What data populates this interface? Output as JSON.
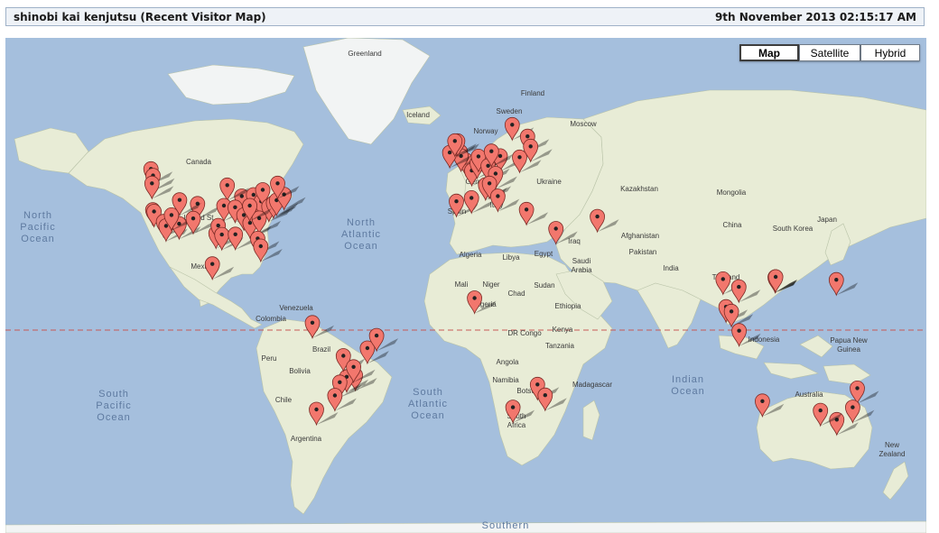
{
  "header": {
    "title": "shinobi kai kenjutsu (Recent Visitor Map)",
    "datetime": "9th November 2013 02:15:17 AM"
  },
  "map_controls": {
    "map": "Map",
    "satellite": "Satellite",
    "hybrid": "Hybrid",
    "active": "Map"
  },
  "colors": {
    "ocean": "#a5bfdd",
    "land": "#e8ecd6",
    "forest": "#c6dca3",
    "ice": "#f2f4f4",
    "desert": "#f1ebd5",
    "marker": "#f2776d",
    "equator": "#c85a55"
  },
  "labels": {
    "greenland": "Greenland",
    "iceland": "Iceland",
    "finland": "Finland",
    "sweden": "Sweden",
    "norway": "Norway",
    "moscow": "Moscow",
    "canada": "Canada",
    "united_states": "United St",
    "mexico": "Mexico",
    "ukraine": "Ukraine",
    "kazakhstan": "Kazakhstan",
    "mongolia": "Mongolia",
    "china": "China",
    "south_korea": "South Korea",
    "japan": "Japan",
    "germany": "Germany",
    "spain": "Spain",
    "italy": "Italy",
    "algeria": "Algeria",
    "libya": "Libya",
    "egypt": "Egypt",
    "iraq": "Iraq",
    "afghanistan": "Afghanistan",
    "pakistan": "Pakistan",
    "india": "India",
    "saudi_arabia": "Saudi\nArabia",
    "mali": "Mali",
    "niger": "Niger",
    "chad": "Chad",
    "sudan": "Sudan",
    "nigeria": "Nigeria",
    "ethiopia": "Ethiopia",
    "dr_congo": "DR Congo",
    "kenya": "Kenya",
    "tanzania": "Tanzania",
    "angola": "Angola",
    "namibia": "Namibia",
    "botswana": "Botswana",
    "madagascar": "Madagascar",
    "south_africa": "South\nAfrica",
    "thailand": "Thailand",
    "indonesia": "Indonesia",
    "papua_new_guinea": "Papua New\nGuinea",
    "australia": "Australia",
    "new_zealand": "New\nZealand",
    "venezuela": "Venezuela",
    "colombia": "Colombia",
    "brazil": "Brazil",
    "peru": "Peru",
    "bolivia": "Bolivia",
    "chile": "Chile",
    "argentina": "Argentina",
    "north_pacific_ocean": "North\nPacific\nOcean",
    "north_atlantic_ocean": "North\nAtlantic\nOcean",
    "south_pacific_ocean": "South\nPacific\nOcean",
    "south_atlantic_ocean": "South\nAtlantic\nOcean",
    "indian_ocean": "Indian\nOcean",
    "southern": "Southern"
  },
  "visitor_markers": [
    [
      -123.1,
      49.3
    ],
    [
      -122.3,
      47.6
    ],
    [
      -122.7,
      45.5
    ],
    [
      -122.4,
      37.8
    ],
    [
      -121.9,
      37.3
    ],
    [
      -118.2,
      34.1
    ],
    [
      -117.2,
      32.7
    ],
    [
      -112.1,
      33.4
    ],
    [
      -115.1,
      36.2
    ],
    [
      -104.9,
      39.7
    ],
    [
      -111.9,
      40.8
    ],
    [
      -106.6,
      35.1
    ],
    [
      -97.7,
      30.3
    ],
    [
      -96.8,
      32.8
    ],
    [
      -95.4,
      29.8
    ],
    [
      -90.1,
      29.9
    ],
    [
      -87.6,
      41.9
    ],
    [
      -93.3,
      45.0
    ],
    [
      -94.6,
      39.1
    ],
    [
      -90.2,
      38.6
    ],
    [
      -86.8,
      36.2
    ],
    [
      -84.4,
      33.7
    ],
    [
      -81.7,
      41.5
    ],
    [
      -83.0,
      42.3
    ],
    [
      -80.0,
      40.4
    ],
    [
      -79.4,
      43.7
    ],
    [
      -77.0,
      38.9
    ],
    [
      -75.2,
      39.9
    ],
    [
      -74.0,
      40.7
    ],
    [
      -71.1,
      42.4
    ],
    [
      -73.6,
      45.5
    ],
    [
      -80.8,
      35.2
    ],
    [
      -81.4,
      28.5
    ],
    [
      -80.2,
      25.8
    ],
    [
      -84.5,
      39.1
    ],
    [
      -99.1,
      19.4
    ],
    [
      -0.1,
      51.5
    ],
    [
      -2.2,
      53.5
    ],
    [
      -1.9,
      52.5
    ],
    [
      -3.2,
      55.9
    ],
    [
      -6.3,
      53.3
    ],
    [
      -4.3,
      55.9
    ],
    [
      2.3,
      48.9
    ],
    [
      4.4,
      50.8
    ],
    [
      4.9,
      52.4
    ],
    [
      8.7,
      50.1
    ],
    [
      13.4,
      52.5
    ],
    [
      11.6,
      48.1
    ],
    [
      10.0,
      53.6
    ],
    [
      -3.7,
      40.4
    ],
    [
      2.2,
      41.4
    ],
    [
      7.7,
      45.1
    ],
    [
      9.2,
      45.5
    ],
    [
      12.5,
      41.9
    ],
    [
      18.1,
      59.3
    ],
    [
      24.1,
      56.9
    ],
    [
      25.3,
      54.7
    ],
    [
      21.0,
      52.2
    ],
    [
      23.7,
      37.9
    ],
    [
      35.2,
      31.8
    ],
    [
      51.4,
      35.7
    ],
    [
      28.0,
      -26.2
    ],
    [
      31.0,
      -29.9
    ],
    [
      18.4,
      -33.9
    ],
    [
      3.4,
      6.5
    ],
    [
      100.5,
      13.8
    ],
    [
      106.7,
      10.8
    ],
    [
      121.0,
      14.6
    ],
    [
      120.9,
      14.4
    ],
    [
      121.1,
      14.6
    ],
    [
      144.8,
      13.5
    ],
    [
      101.7,
      3.1
    ],
    [
      103.8,
      1.3
    ],
    [
      106.8,
      -6.2
    ],
    [
      153.0,
      -27.5
    ],
    [
      151.2,
      -33.9
    ],
    [
      145.0,
      -37.8
    ],
    [
      138.6,
      -34.9
    ],
    [
      115.9,
      -31.9
    ],
    [
      -43.2,
      -22.9
    ],
    [
      -46.6,
      -23.5
    ],
    [
      -49.3,
      -25.4
    ],
    [
      -51.2,
      -30.0
    ],
    [
      -47.9,
      -15.8
    ],
    [
      -43.9,
      -19.9
    ],
    [
      -38.5,
      -12.9
    ],
    [
      -60.0,
      -3.1
    ],
    [
      -58.4,
      -34.6
    ],
    [
      -34.9,
      -8.1
    ]
  ]
}
